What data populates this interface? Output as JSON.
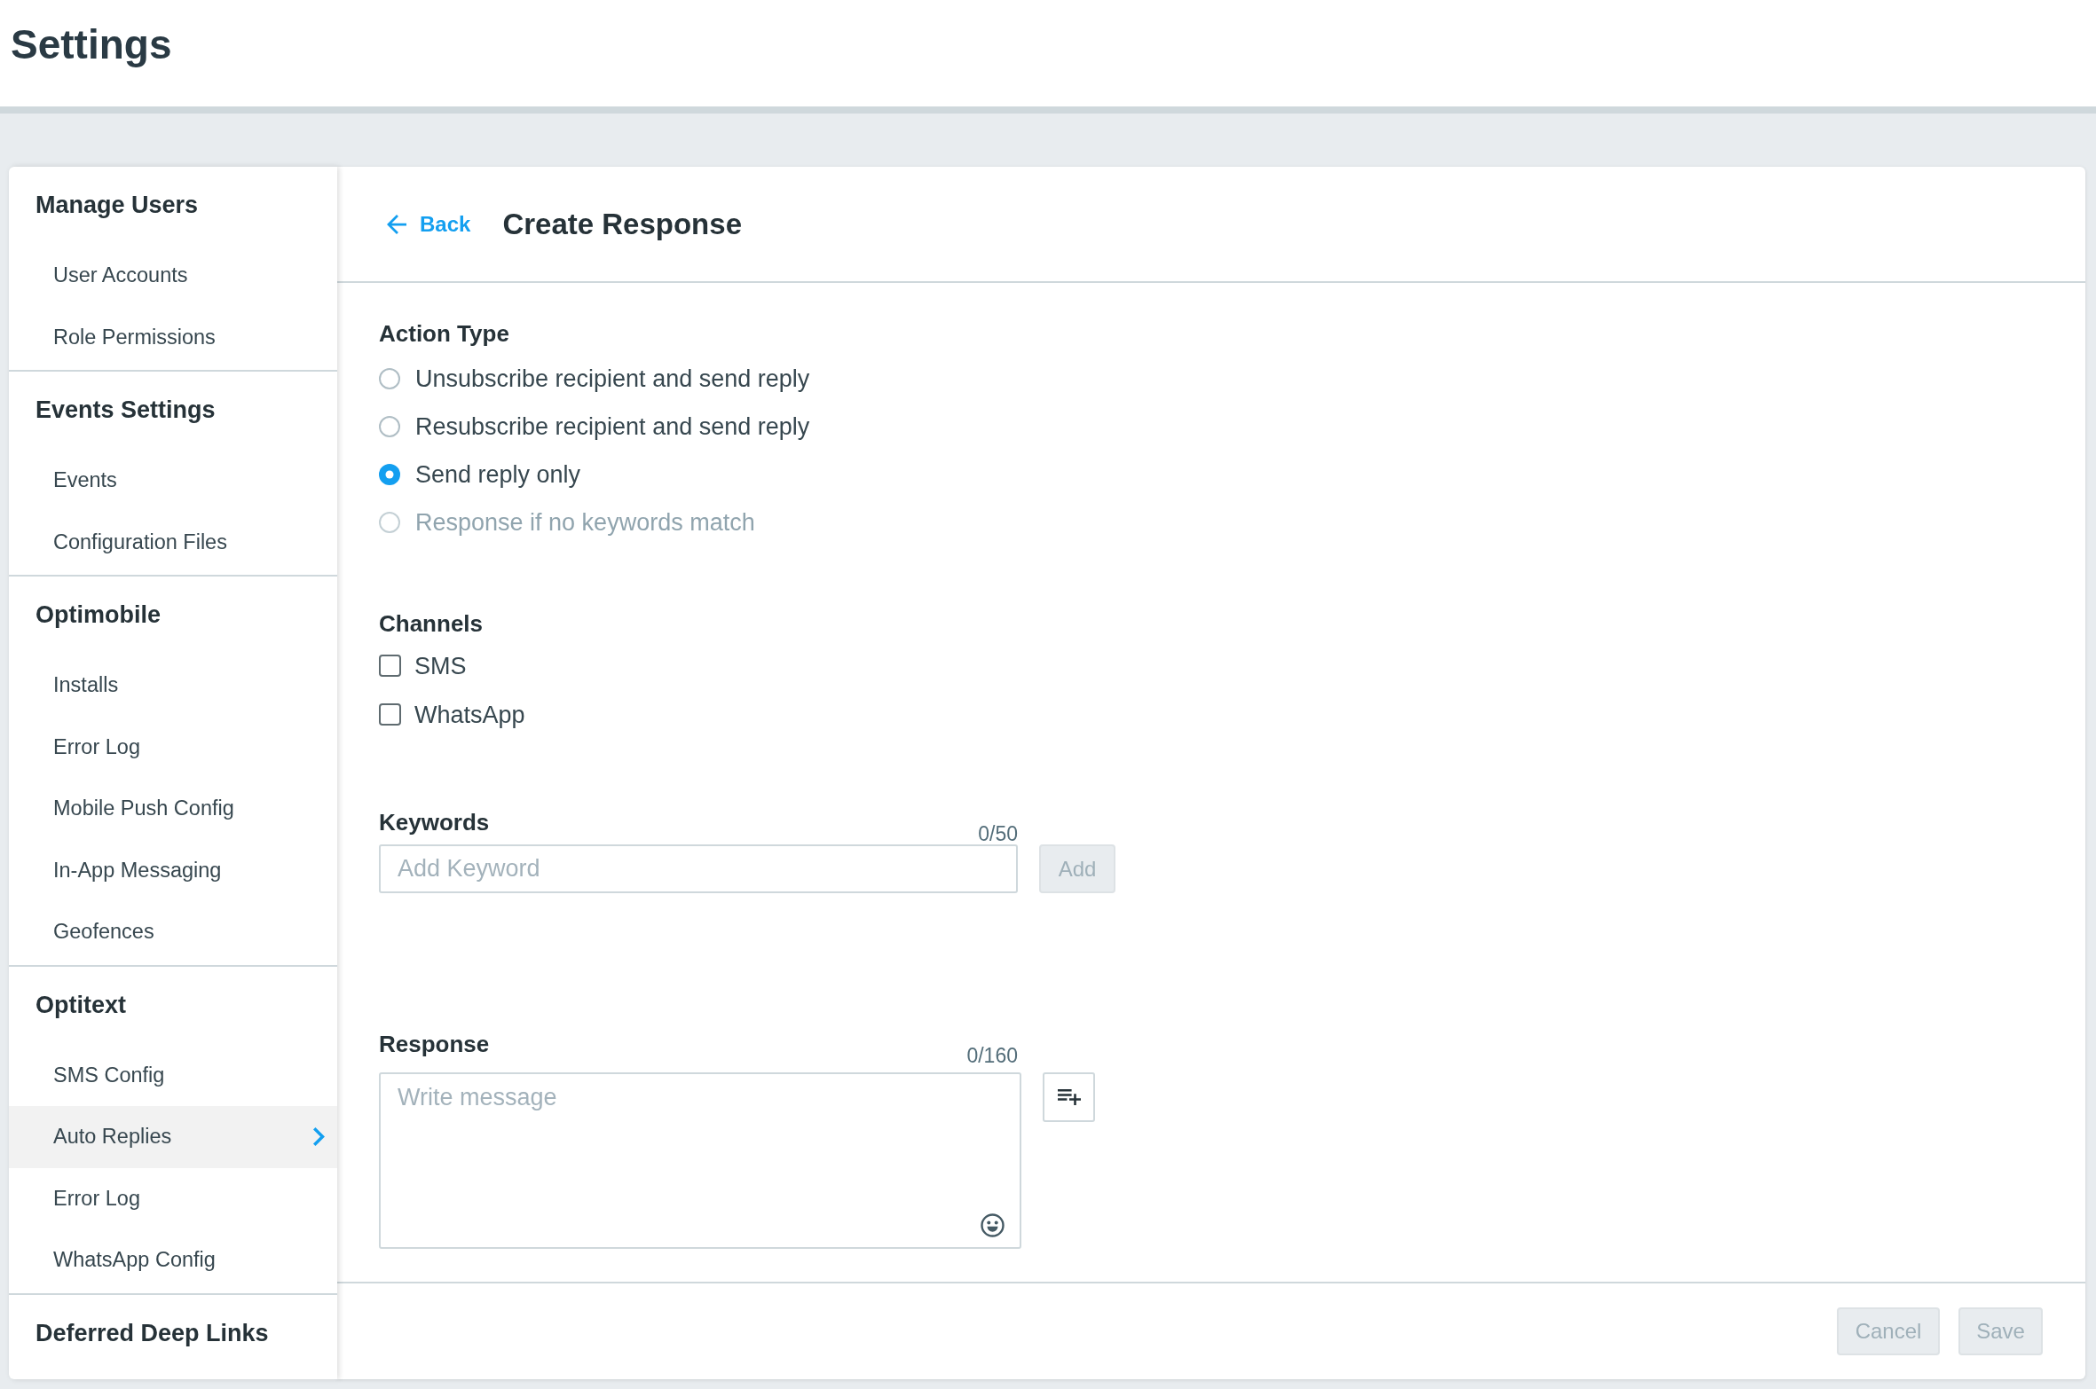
{
  "page": {
    "title": "Settings"
  },
  "sidebar": {
    "groups": [
      {
        "heading": "Manage Users",
        "items": [
          {
            "label": "User Accounts",
            "selected": false
          },
          {
            "label": "Role Permissions",
            "selected": false
          }
        ]
      },
      {
        "heading": "Events Settings",
        "items": [
          {
            "label": "Events",
            "selected": false
          },
          {
            "label": "Configuration Files",
            "selected": false
          }
        ]
      },
      {
        "heading": "Optimobile",
        "items": [
          {
            "label": "Installs",
            "selected": false
          },
          {
            "label": "Error Log",
            "selected": false
          },
          {
            "label": "Mobile Push Config",
            "selected": false
          },
          {
            "label": "In-App Messaging",
            "selected": false
          },
          {
            "label": "Geofences",
            "selected": false
          }
        ]
      },
      {
        "heading": "Optitext",
        "items": [
          {
            "label": "SMS Config",
            "selected": false
          },
          {
            "label": "Auto Replies",
            "selected": true
          },
          {
            "label": "Error Log",
            "selected": false
          },
          {
            "label": "WhatsApp Config",
            "selected": false
          }
        ]
      },
      {
        "heading": "Deferred Deep Links"
      }
    ]
  },
  "panel": {
    "back_link": "Back",
    "title": "Create Response",
    "action_type": {
      "label": "Action Type",
      "options": [
        {
          "label": "Unsubscribe recipient and send reply",
          "selected": false,
          "disabled": false
        },
        {
          "label": "Resubscribe recipient and send reply",
          "selected": false,
          "disabled": false
        },
        {
          "label": "Send reply only",
          "selected": true,
          "disabled": false
        },
        {
          "label": "Response if no keywords match",
          "selected": false,
          "disabled": true
        }
      ]
    },
    "channels": {
      "label": "Channels",
      "options": [
        {
          "label": "SMS",
          "checked": false
        },
        {
          "label": "WhatsApp",
          "checked": false
        }
      ]
    },
    "keywords": {
      "label": "Keywords",
      "counter": "0/50",
      "placeholder": "Add Keyword",
      "add_button": {
        "label": "Add",
        "disabled": true
      }
    },
    "response": {
      "label": "Response",
      "counter": "0/160",
      "placeholder": "Write message"
    },
    "footer_buttons": [
      {
        "label": "Cancel",
        "disabled": true
      },
      {
        "label": "Save",
        "disabled": true
      }
    ]
  }
}
